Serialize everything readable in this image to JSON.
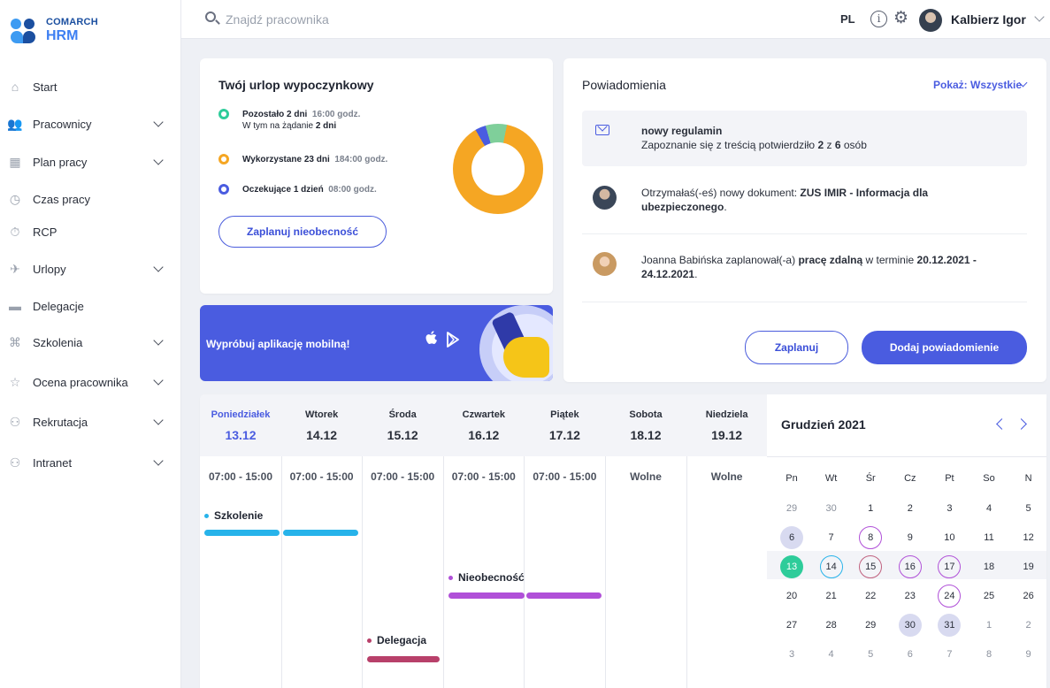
{
  "brand": {
    "line1": "COMARCH",
    "line2": "HRM"
  },
  "sidebar": {
    "items": [
      {
        "label": "Start",
        "icon": "home-icon",
        "glyph": "⌂",
        "has_chevron": false
      },
      {
        "label": "Pracownicy",
        "icon": "people-icon",
        "glyph": "👥",
        "has_chevron": true
      },
      {
        "label": "Plan pracy",
        "icon": "calendar-grid-icon",
        "glyph": "▦",
        "has_chevron": true
      },
      {
        "label": "Czas pracy",
        "icon": "clock-icon",
        "glyph": "◷",
        "has_chevron": false
      },
      {
        "label": "RCP",
        "icon": "stopwatch-icon",
        "glyph": "⏱",
        "has_chevron": false
      },
      {
        "label": "Urlopy",
        "icon": "plane-icon",
        "glyph": "✈",
        "has_chevron": true
      },
      {
        "label": "Delegacje",
        "icon": "briefcase-icon",
        "glyph": "▬",
        "has_chevron": false
      },
      {
        "label": "Szkolenia",
        "icon": "graduation-icon",
        "glyph": "⌘",
        "has_chevron": true
      },
      {
        "label": "Ocena pracownika",
        "icon": "rating-icon",
        "glyph": "☆",
        "has_chevron": true
      },
      {
        "label": "Rekrutacja",
        "icon": "recruit-icon",
        "glyph": "⚇",
        "has_chevron": true
      },
      {
        "label": "Intranet",
        "icon": "intranet-icon",
        "glyph": "⚇",
        "has_chevron": true
      }
    ]
  },
  "topbar": {
    "search_placeholder": "Znajdź pracownika",
    "language": "PL",
    "user_name": "Kalbierz Igor"
  },
  "leave": {
    "title": "Twój urlop wypoczynkowy",
    "remaining": {
      "label": "Pozostało 2 dni",
      "hours": "16:00 godz.",
      "sub_prefix": "W tym na żądanie",
      "sub_value": "2 dni",
      "color": "#2ecc9a"
    },
    "used": {
      "label": "Wykorzystane 23 dni",
      "hours": "184:00 godz.",
      "color": "#f5a623"
    },
    "pending": {
      "label": "Oczekujące 1 dzień",
      "hours": "08:00 godz.",
      "color": "#4a5ce0"
    },
    "chart": {
      "used_days": 23,
      "remaining_days": 2,
      "pending_days": 1
    },
    "plan_button": "Zaplanuj nieobecność"
  },
  "mobile": {
    "text": "Wypróbuj aplikację mobilną!"
  },
  "notifications": {
    "title": "Powiadomienia",
    "filter": "Pokaż: Wszystkie",
    "items": [
      {
        "title": "nowy regulamin",
        "line2_prefix": "Zapoznanie się z treścią potwierdziło",
        "confirmed": "2",
        "of": "z",
        "total": "6",
        "suffix": "osób"
      },
      {
        "prefix": "Otrzymałaś(-eś) nowy dokument:",
        "document": "ZUS IMIR - Informacja dla ubezpieczonego",
        "end": "."
      },
      {
        "prefix": "Joanna Babińska zaplanował(-a)",
        "work": "pracę zdalną",
        "mid": "w terminie",
        "range": "20.12.2021 - 24.12.2021",
        "end": "."
      }
    ],
    "plan_button": "Zaplanuj",
    "add_button": "Dodaj powiadomienie"
  },
  "week": {
    "days": [
      {
        "name": "Poniedziałek",
        "date": "13.12",
        "hours": "07:00 - 15:00",
        "today": true
      },
      {
        "name": "Wtorek",
        "date": "14.12",
        "hours": "07:00 - 15:00",
        "today": false
      },
      {
        "name": "Środa",
        "date": "15.12",
        "hours": "07:00 - 15:00",
        "today": false
      },
      {
        "name": "Czwartek",
        "date": "16.12",
        "hours": "07:00 - 15:00",
        "today": false
      },
      {
        "name": "Piątek",
        "date": "17.12",
        "hours": "07:00 - 15:00",
        "today": false
      },
      {
        "name": "Sobota",
        "date": "18.12",
        "hours": "Wolne",
        "today": false
      },
      {
        "name": "Niedziela",
        "date": "19.12",
        "hours": "Wolne",
        "today": false
      }
    ],
    "events": [
      {
        "label": "Szkolenie",
        "color": "#27b3ea"
      },
      {
        "label": "Nieobecność",
        "color": "#b050d8"
      },
      {
        "label": "Delegacja",
        "color": "#b8406a"
      }
    ]
  },
  "calendar": {
    "title": "Grudzień 2021",
    "dow": [
      "Pn",
      "Wt",
      "Śr",
      "Cz",
      "Pt",
      "So",
      "N"
    ],
    "weeks": [
      [
        "29",
        "30",
        "1",
        "2",
        "3",
        "4",
        "5"
      ],
      [
        "6",
        "7",
        "8",
        "9",
        "10",
        "11",
        "12"
      ],
      [
        "13",
        "14",
        "15",
        "16",
        "17",
        "18",
        "19"
      ],
      [
        "20",
        "21",
        "22",
        "23",
        "24",
        "25",
        "26"
      ],
      [
        "27",
        "28",
        "29",
        "30",
        "31",
        "1",
        "2"
      ],
      [
        "3",
        "4",
        "5",
        "6",
        "7",
        "8",
        "9"
      ]
    ],
    "colors": {
      "today": "#2ecc9a",
      "filled": "#d8daf0",
      "ring_blue": "#27b3ea",
      "ring_rose": "#c0607e",
      "ring_purple": "#b050d8"
    }
  },
  "colors": {
    "accent": "#4a5ce0",
    "used": "#f5a623",
    "remaining": "#2ecc9a"
  }
}
